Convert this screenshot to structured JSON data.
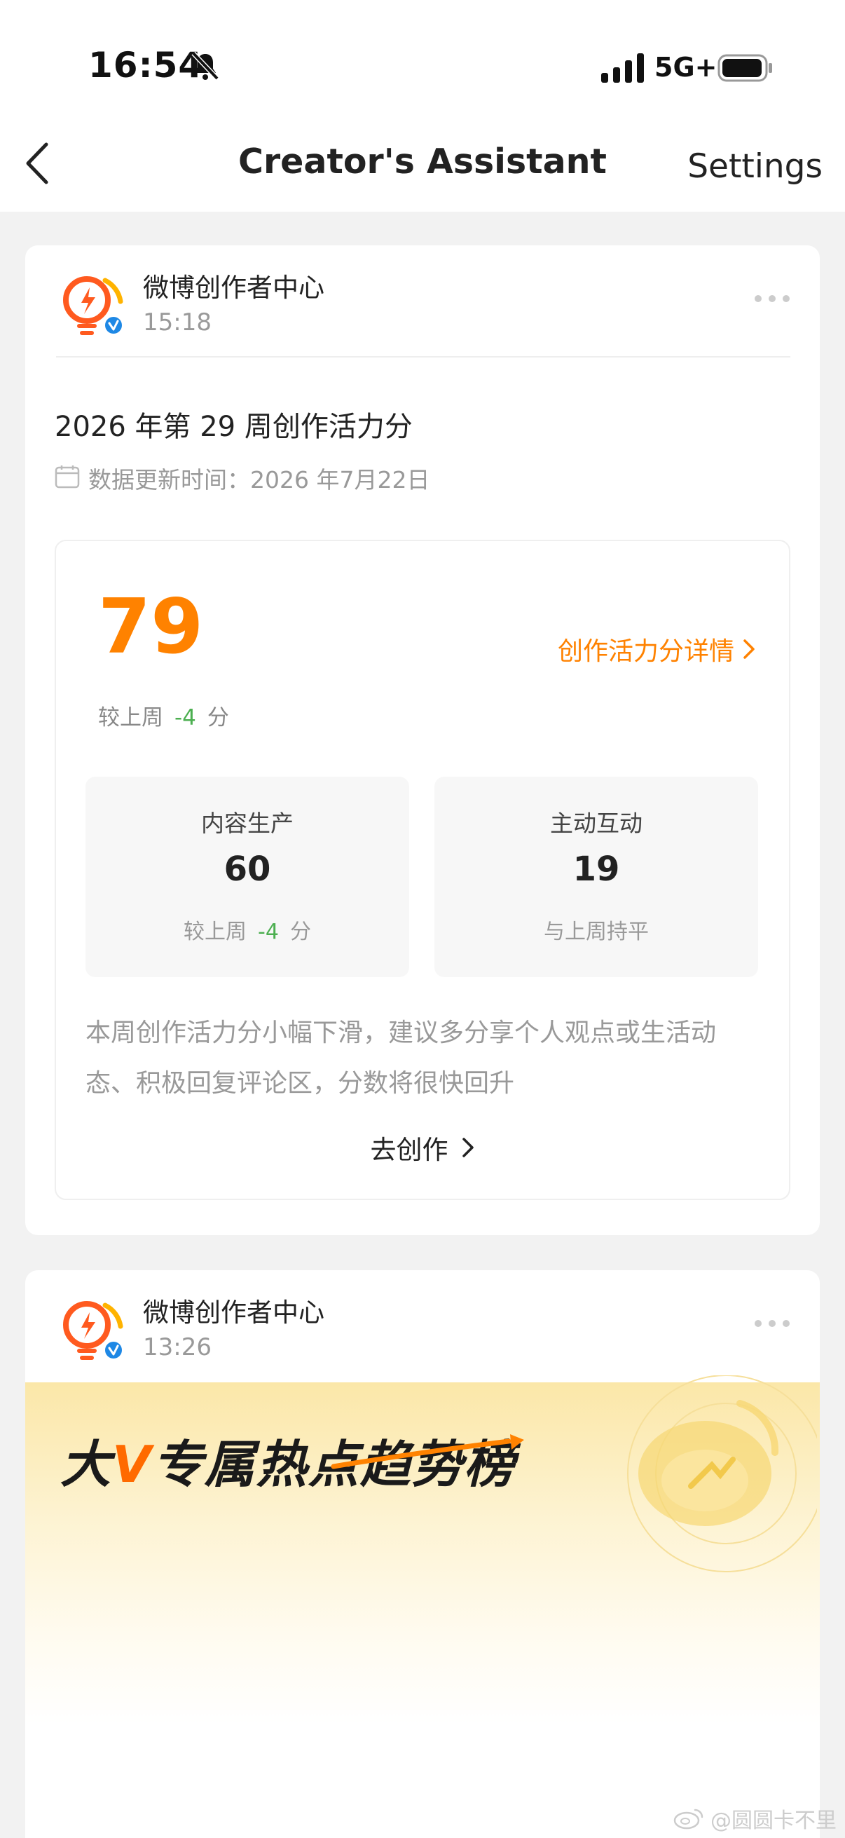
{
  "status_bar": {
    "time": "16:54",
    "network": "5G+"
  },
  "nav": {
    "title": "Creator's Assistant",
    "settings_label": "Settings"
  },
  "message1": {
    "sender": "微博创作者中心",
    "time": "15:18",
    "heading": "2026 年第 29 周创作活力分",
    "update_text": "数据更新时间：2026 年7月22日",
    "score": "79",
    "detail_link": "创作活力分详情",
    "compare_prefix": "较上周",
    "compare_value": "-4",
    "compare_unit": "分",
    "tiles": [
      {
        "label": "内容生产",
        "value": "60",
        "sub_prefix": "较上周",
        "sub_value": "-4",
        "sub_unit": "分"
      },
      {
        "label": "主动互动",
        "value": "19",
        "sub_text": "与上周持平"
      }
    ],
    "advice": "本周创作活力分小幅下滑，建议多分享个人观点或生活动态、积极回复评论区，分数将很快回升",
    "create_label": "去创作"
  },
  "message2": {
    "sender": "微博创作者中心",
    "time": "13:26",
    "banner_title_pre": "大",
    "banner_title_v": "V",
    "banner_title_post": "专属热点趋势榜"
  },
  "watermark": "@圆圆卡不里",
  "colors": {
    "accent": "#ff8200",
    "negative": "#4caf50",
    "verified": "#1e88e5"
  }
}
